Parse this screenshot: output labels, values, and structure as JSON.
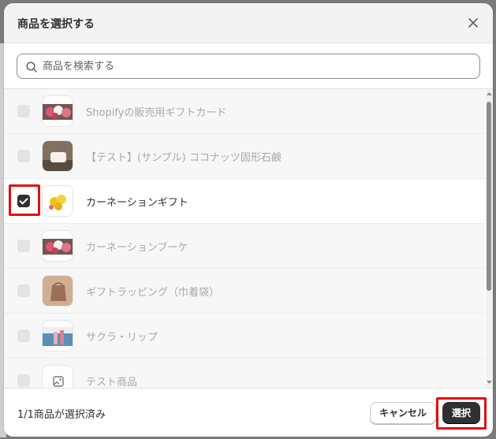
{
  "dialog": {
    "title": "商品を選択する",
    "close_icon": "close-icon"
  },
  "search": {
    "placeholder": "商品を検索する",
    "value": ""
  },
  "products": [
    {
      "label": "Shopifyの販売用ギフトカード",
      "checked": false,
      "thumb": "flowers-pink"
    },
    {
      "label": "【テスト】(サンプル) ココナッツ固形石鹸",
      "checked": false,
      "thumb": "soap"
    },
    {
      "label": "カーネーションギフト",
      "checked": true,
      "thumb": "flowers-yellow"
    },
    {
      "label": "カーネーションブーケ",
      "checked": false,
      "thumb": "flowers-pink"
    },
    {
      "label": "ギフトラッピング（巾着袋）",
      "checked": false,
      "thumb": "pouch"
    },
    {
      "label": "サクラ・リップ",
      "checked": false,
      "thumb": "lipstick"
    },
    {
      "label": "テスト商品",
      "checked": false,
      "thumb": "image-placeholder-icon"
    }
  ],
  "footer": {
    "selection_count": "1/1商品が選択済み",
    "cancel_label": "キャンセル",
    "select_label": "選択"
  },
  "colors": {
    "primary_button": "#303030",
    "highlight": "#e01010"
  }
}
